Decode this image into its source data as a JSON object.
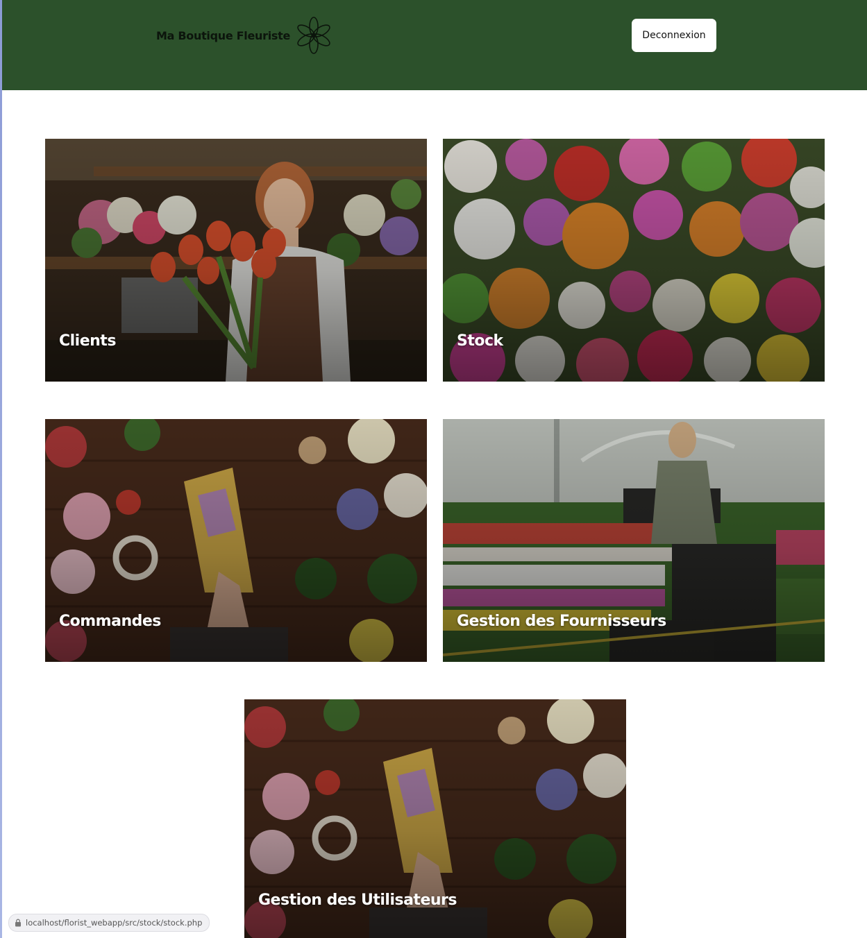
{
  "header": {
    "brand_name": "Ma Boutique Fleuriste",
    "brand_icon": "flower-icon",
    "logout_label": "Deconnexion",
    "background_color": "#2c512b"
  },
  "cards": [
    {
      "label": "Clients",
      "image": "florist-with-tulips"
    },
    {
      "label": "Stock",
      "image": "wall-of-flowers"
    },
    {
      "label": "Commandes",
      "image": "bouquet-wrapping-table"
    },
    {
      "label": "Gestion des Fournisseurs",
      "image": "greenhouse-nursery"
    },
    {
      "label": "Gestion des Utilisateurs",
      "image": "bouquet-wrapping-table"
    }
  ],
  "status_bar": {
    "url": "localhost/florist_webapp/src/stock/stock.php",
    "icon": "lock-icon"
  }
}
